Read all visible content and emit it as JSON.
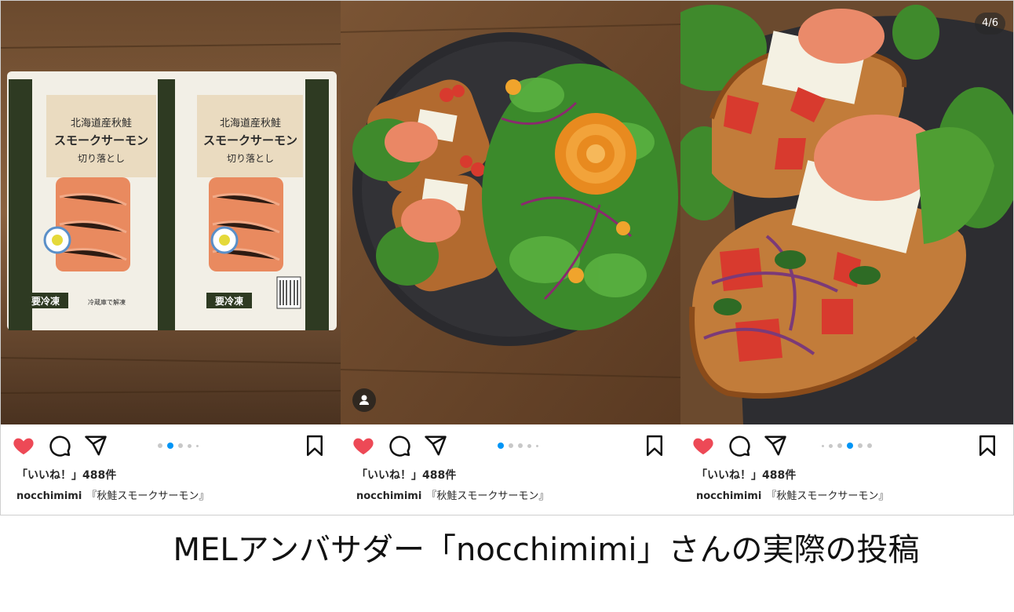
{
  "posts": [
    {
      "likes_text": "「いいね！」488件",
      "username": "nocchimimi",
      "caption": "『秋鮭スモークサーモン』",
      "carousel_active_index": 1,
      "carousel_dot_count": 5,
      "package_text": {
        "title_line1": "北海道産秋鮭",
        "title_line2": "スモークサーモン",
        "cut_label": "切り落とし",
        "frozen_label": "要冷凍",
        "thaw_label": "冷蔵庫で解凍"
      }
    },
    {
      "likes_text": "「いいね！」488件",
      "username": "nocchimimi",
      "caption": "『秋鮭スモークサーモン』",
      "carousel_active_index": 0,
      "carousel_dot_count": 5
    },
    {
      "likes_text": "「いいね！」488件",
      "username": "nocchimimi",
      "caption": "『秋鮭スモークサーモン』",
      "carousel_active_index": 3,
      "carousel_dot_count": 6,
      "counter": "4/6"
    }
  ],
  "footer": {
    "caption": "MELアンバサダー「nocchimimi」さんの実際の投稿"
  },
  "colors": {
    "like_red": "#ed4956",
    "dot_active": "#0095f6",
    "dot_inactive": "#c8c8c8"
  },
  "icons": [
    "heart-icon",
    "comment-icon",
    "share-icon",
    "bookmark-icon",
    "user-icon"
  ]
}
